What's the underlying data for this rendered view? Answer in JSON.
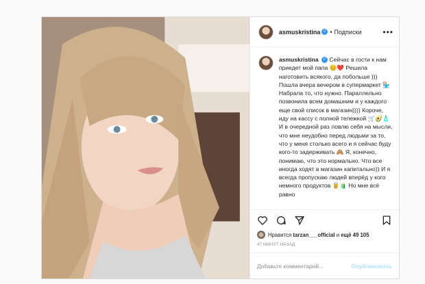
{
  "post": {
    "username": "asmuskristina",
    "separator": "•",
    "follow_label": "Подписки",
    "more_icon": "ellipsis-icon",
    "caption": "Сейчас в гости к нам приедет мой папа 😊❤️ Решила наготовить всякого, да побольше ))) Пошла вчера вечером в супермаркет 🏪 Набрала то, что нужно. Параллельно позвонила всем домашним и у каждого еще свой список в магазин)))) Короче, иду на кассу с полной тележкой 🛒🥑🧴 И в очередной раз ловлю себя на мысли, что мне неудобно перед людьми за то, что у меня столько всего и я сейчас буду кого-то задерживать 🙈 Я, конечно, понимаю, что это нормально. Что все иногда ходят в магазин капитально)) И я всегда пропускаю людей вперёд у кого немного продуктов 🥫🧃 Но мне всё равно",
    "likes_prefix": "Нравится",
    "likes_user": "tarzan___official",
    "likes_mid": "и",
    "likes_count": "ещё 49 105",
    "time_ago": "47 МИНУТ НАЗАД",
    "comment_placeholder": "Добавьте комментарий...",
    "publish_label": "Опубликовать"
  }
}
